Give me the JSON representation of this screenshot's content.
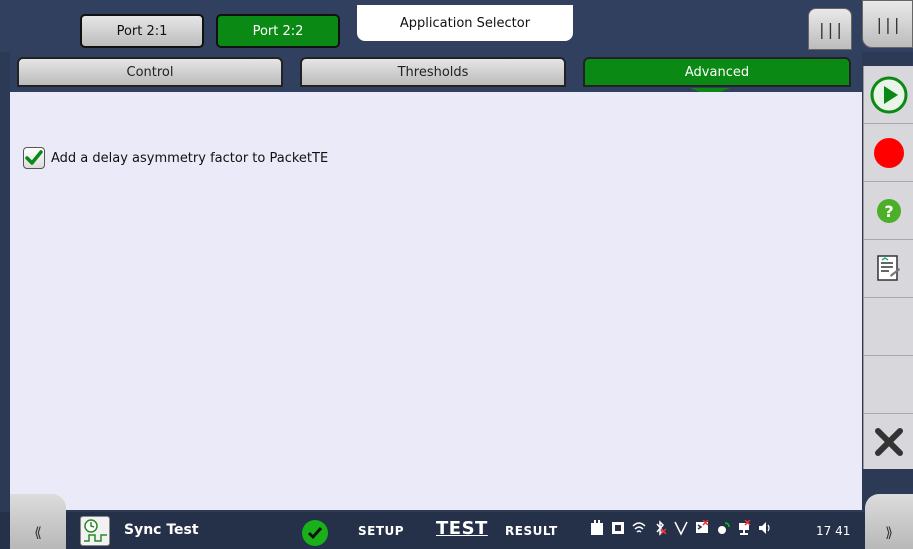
{
  "header": {
    "ports": [
      "Port 2:1",
      "Port 2:2"
    ],
    "app_selector": "Application Selector"
  },
  "tabs": [
    {
      "label": "Control"
    },
    {
      "label": "Thresholds"
    },
    {
      "label": "Advanced",
      "active": true
    }
  ],
  "content": {
    "option_label": "Add a delay asymmetry factor to PacketTE",
    "option_checked": true
  },
  "sidebar": {
    "icons": [
      "play-icon",
      "record-icon",
      "help-icon",
      "report-icon",
      "empty",
      "empty",
      "close-icon"
    ]
  },
  "bottombar": {
    "app_name": "Sync Test",
    "modes": [
      "SETUP",
      "TEST",
      "RESULT"
    ],
    "active_mode": "TEST",
    "clock": "17 41"
  },
  "colors": {
    "accent": "#0a8a14",
    "record": "#ff0000",
    "background": "#eaeaf8"
  }
}
